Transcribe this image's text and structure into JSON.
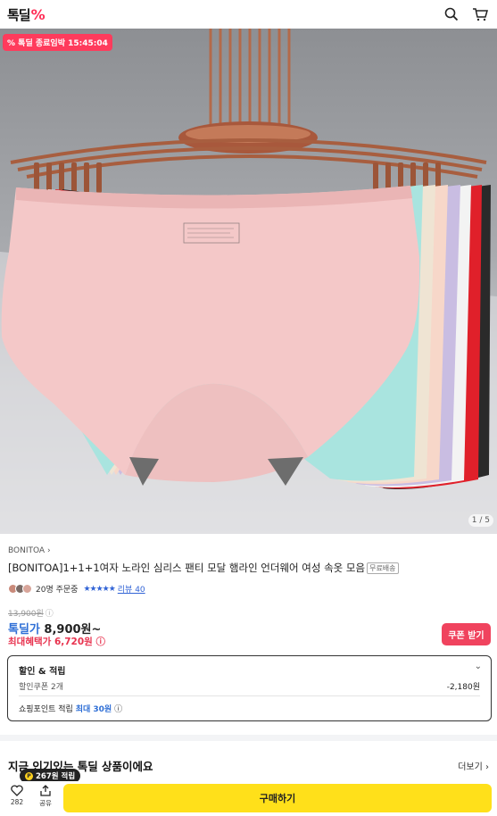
{
  "header": {
    "logo_text": "톡딜",
    "logo_mark": "%"
  },
  "hero": {
    "timer_icon": "%",
    "timer_text": "톡딜 종료임박 15:45:04",
    "counter": "1 / 5"
  },
  "product": {
    "brand": "BONITOA",
    "title": "[BONITOA]1+1+1여자 노라인 심리스 팬티 모달 햄라인 언더웨어 여성 속옷 모음",
    "free_shipping": "무료배송",
    "order_count": "20명 주문중",
    "stars": "★★★★★",
    "review": "리뷰 40",
    "original_price": "13,900원",
    "deal_label": "톡딜가",
    "deal_price": "8,900원~",
    "max_benefit": "최대혜택가 6,720원",
    "coupon_button": "쿠폰 받기"
  },
  "benefit": {
    "heading": "할인 & 적립",
    "coupon_label": "할인쿠폰 2개",
    "coupon_value": "-2,180원",
    "points_label": "쇼핑포인트 적립",
    "points_value": "최대 30원"
  },
  "section": {
    "title": "지금 인기있는 톡딜 상품이에요",
    "more": "더보기"
  },
  "bottom": {
    "likes": "282",
    "share": "공유",
    "points_pill": "267원 적립",
    "buy": "구매하기"
  },
  "colors": {
    "accent": "#ff2d55",
    "buy": "#ffe01a",
    "link": "#2f6fd6"
  }
}
